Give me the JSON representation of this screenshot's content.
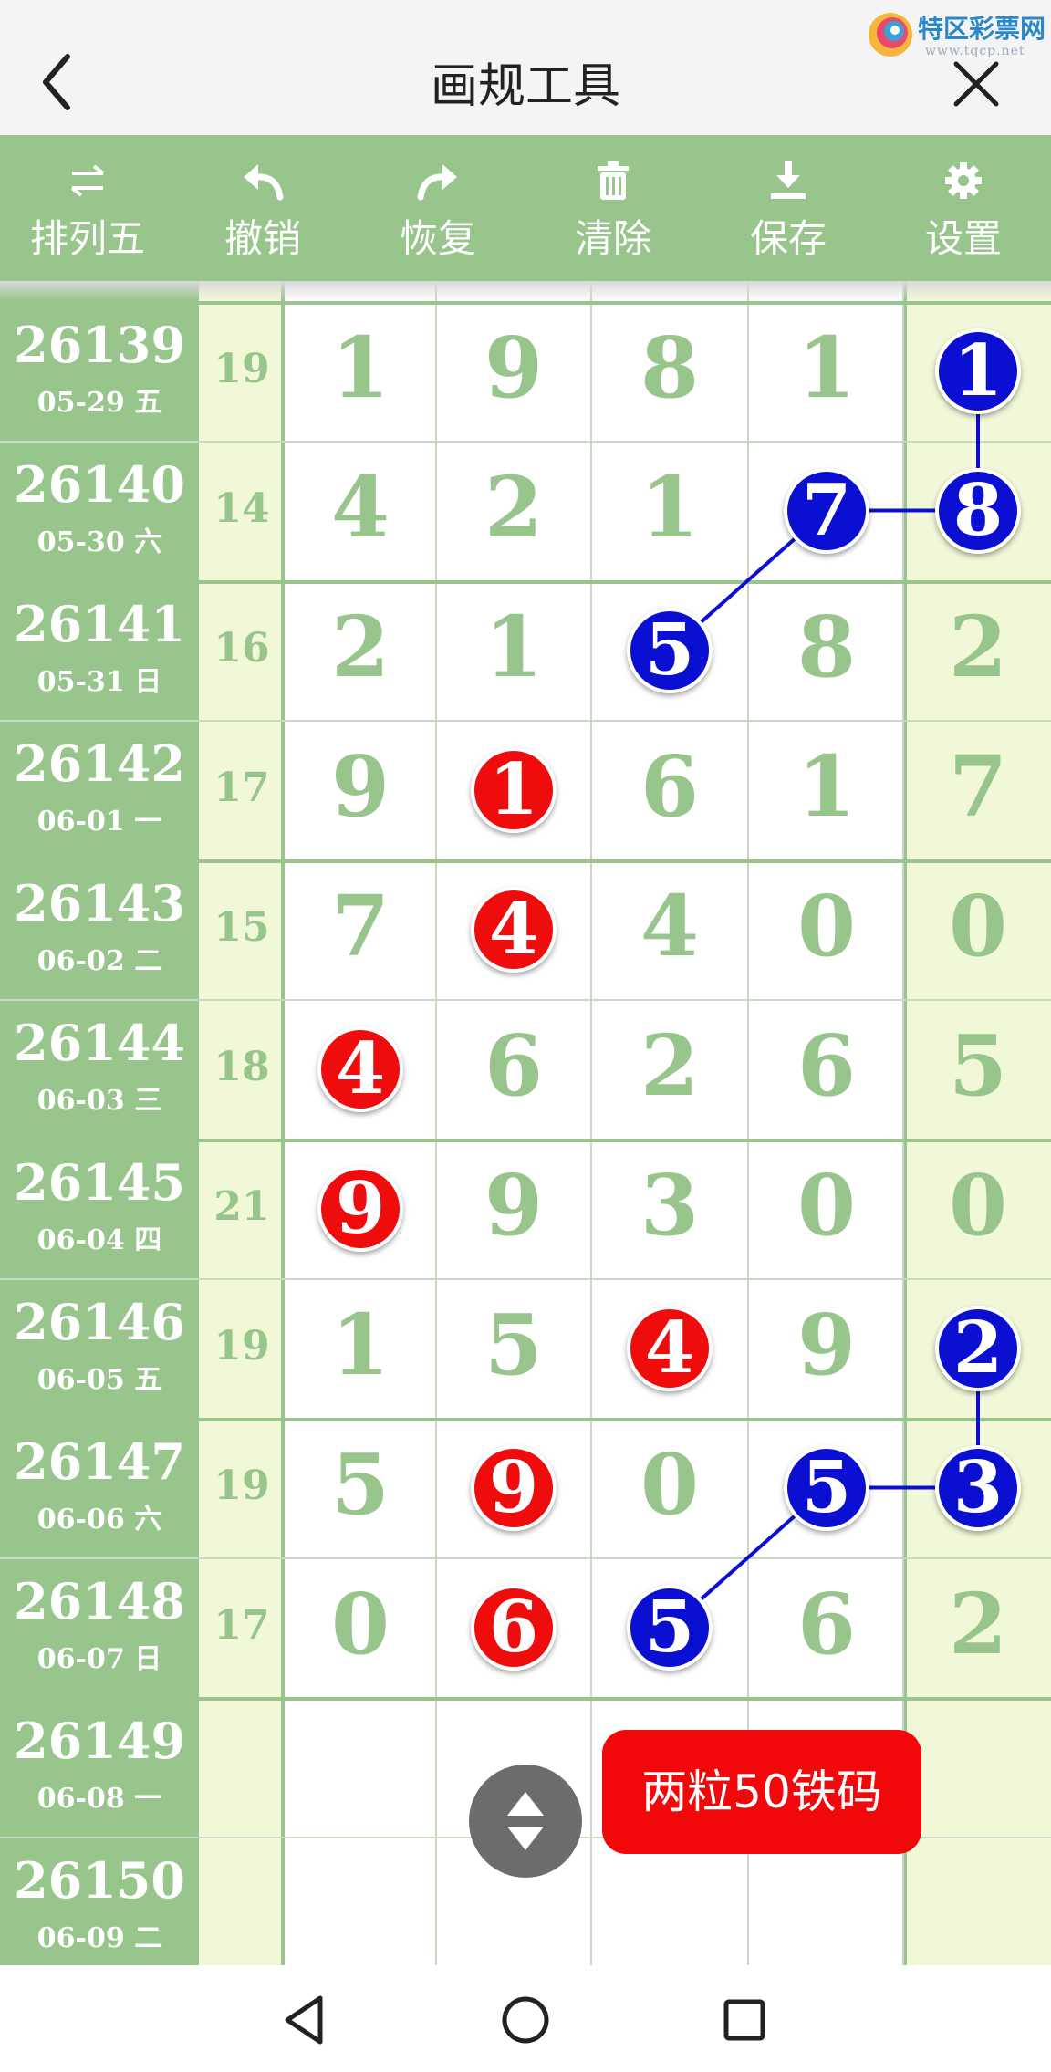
{
  "title": "画规工具",
  "logo": {
    "brand": "特区彩票网",
    "url": "www.tqcp.net"
  },
  "toolbar": [
    {
      "label": "排列五",
      "icon": "swap-arrows-icon"
    },
    {
      "label": "撤销",
      "icon": "undo-icon"
    },
    {
      "label": "恢复",
      "icon": "redo-icon"
    },
    {
      "label": "清除",
      "icon": "trash-icon"
    },
    {
      "label": "保存",
      "icon": "download-icon"
    },
    {
      "label": "设置",
      "icon": "gear-icon"
    }
  ],
  "rows": [
    {
      "issue": "26139",
      "date": "05-29 五",
      "sum": "19",
      "digits": [
        "1",
        "9",
        "8",
        "1",
        "1"
      ],
      "marks": [
        "",
        "",
        "",
        "",
        "blue"
      ]
    },
    {
      "issue": "26140",
      "date": "05-30 六",
      "sum": "14",
      "digits": [
        "4",
        "2",
        "1",
        "7",
        "8"
      ],
      "marks": [
        "",
        "",
        "",
        "blue",
        "blue"
      ]
    },
    {
      "issue": "26141",
      "date": "05-31 日",
      "sum": "16",
      "digits": [
        "2",
        "1",
        "5",
        "8",
        "2"
      ],
      "marks": [
        "",
        "",
        "blue",
        "",
        ""
      ]
    },
    {
      "issue": "26142",
      "date": "06-01 一",
      "sum": "17",
      "digits": [
        "9",
        "1",
        "6",
        "1",
        "7"
      ],
      "marks": [
        "",
        "red",
        "",
        "",
        ""
      ]
    },
    {
      "issue": "26143",
      "date": "06-02 二",
      "sum": "15",
      "digits": [
        "7",
        "4",
        "4",
        "0",
        "0"
      ],
      "marks": [
        "",
        "red",
        "",
        "",
        ""
      ]
    },
    {
      "issue": "26144",
      "date": "06-03 三",
      "sum": "18",
      "digits": [
        "4",
        "6",
        "2",
        "6",
        "5"
      ],
      "marks": [
        "red",
        "",
        "",
        "",
        ""
      ]
    },
    {
      "issue": "26145",
      "date": "06-04 四",
      "sum": "21",
      "digits": [
        "9",
        "9",
        "3",
        "0",
        "0"
      ],
      "marks": [
        "red",
        "",
        "",
        "",
        ""
      ]
    },
    {
      "issue": "26146",
      "date": "06-05 五",
      "sum": "19",
      "digits": [
        "1",
        "5",
        "4",
        "9",
        "2"
      ],
      "marks": [
        "",
        "",
        "red",
        "",
        "blue"
      ]
    },
    {
      "issue": "26147",
      "date": "06-06 六",
      "sum": "19",
      "digits": [
        "5",
        "9",
        "0",
        "5",
        "3"
      ],
      "marks": [
        "",
        "red",
        "",
        "blue",
        "blue"
      ]
    },
    {
      "issue": "26148",
      "date": "06-07 日",
      "sum": "17",
      "digits": [
        "0",
        "6",
        "5",
        "6",
        "2"
      ],
      "marks": [
        "",
        "red",
        "blue",
        "",
        ""
      ]
    },
    {
      "issue": "26149",
      "date": "06-08 一",
      "sum": "",
      "digits": [
        "",
        "",
        "",
        "",
        ""
      ],
      "marks": [
        "",
        "",
        "",
        "",
        ""
      ]
    },
    {
      "issue": "26150",
      "date": "06-09 二",
      "sum": "",
      "digits": [
        "",
        "",
        "",
        "",
        ""
      ],
      "marks": [
        "",
        "",
        "",
        "",
        ""
      ]
    }
  ],
  "links": [
    [
      [
        0,
        4
      ],
      [
        1,
        4
      ]
    ],
    [
      [
        1,
        3
      ],
      [
        1,
        4
      ]
    ],
    [
      [
        1,
        3
      ],
      [
        2,
        2
      ]
    ],
    [
      [
        7,
        4
      ],
      [
        8,
        4
      ]
    ],
    [
      [
        8,
        3
      ],
      [
        8,
        4
      ]
    ],
    [
      [
        8,
        3
      ],
      [
        9,
        2
      ]
    ]
  ],
  "colors": {
    "green": "#98c58b",
    "light": "#f1f8d8",
    "red": "#ee0c0c",
    "blue": "#0b0fd2"
  },
  "promo": "两粒50铁码",
  "navbar": [
    "back-triangle-icon",
    "home-circle-icon",
    "recents-square-icon"
  ]
}
